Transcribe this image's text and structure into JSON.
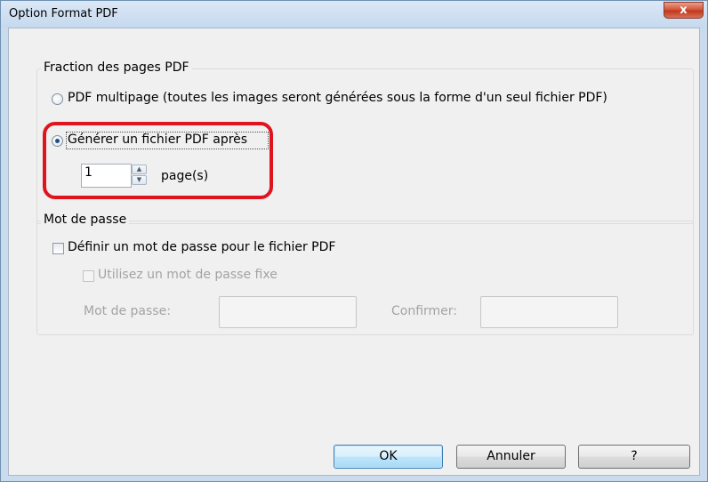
{
  "window": {
    "title": "Option Format PDF",
    "close_label": "x"
  },
  "pages_group": {
    "title": "Fraction des pages PDF",
    "option_multipage": "PDF multipage (toutes les images seront générées sous la forme d'un seul fichier PDF)",
    "option_split": "Générer un fichier PDF après",
    "split_selected": true,
    "page_count": "1",
    "page_unit": "page(s)"
  },
  "password_group": {
    "title": "Mot de passe",
    "set_password_label": "Définir un mot de passe pour le fichier PDF",
    "set_password_checked": false,
    "fixed_password_label": "Utilisez un mot de passe fixe",
    "fixed_password_checked": false,
    "password_label": "Mot de passe:",
    "password_value": "",
    "confirm_label": "Confirmer:",
    "confirm_value": ""
  },
  "buttons": {
    "ok": "OK",
    "cancel": "Annuler",
    "help": "?"
  },
  "colors": {
    "highlight": "#e0141e",
    "default_button_border": "#3c7fb1"
  }
}
